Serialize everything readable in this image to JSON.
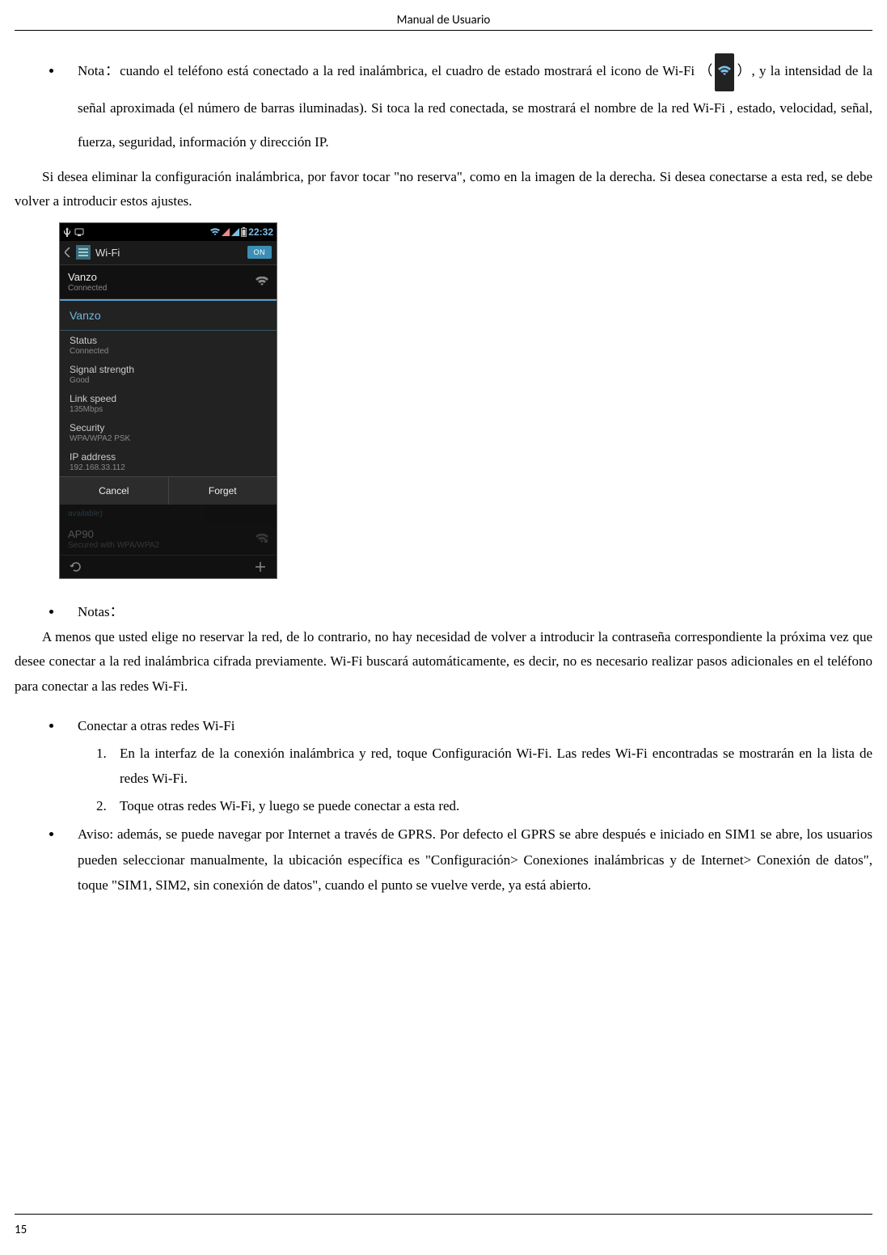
{
  "header": {
    "title": "Manual de Usuario"
  },
  "nota": {
    "label": "Nota：",
    "part1": "cuando el teléfono está conectado a la red inalámbrica, el cuadro de estado mostrará el icono de Wi-Fi （",
    "part2": "）, y la intensidad de la señal aproximada (el número de barras iluminadas). Si toca la red conectada, se mostrará el nombre de la red Wi-Fi , estado, velocidad, señal, fuerza, seguridad, información y dirección IP."
  },
  "flow1": "Si desea eliminar la configuración inalámbrica, por favor tocar \"no reserva\", como en la imagen de la derecha. Si desea conectarse a esta red, se debe volver a introducir estos ajustes.",
  "phone": {
    "time": "22:32",
    "appbar_title": "Wi-Fi",
    "toggle": "ON",
    "net1": {
      "name": "Vanzo",
      "sub": "Connected"
    },
    "dialog": {
      "title": "Vanzo",
      "status_l": "Status",
      "status_v": "Connected",
      "signal_l": "Signal strength",
      "signal_v": "Good",
      "link_l": "Link speed",
      "link_v": "135Mbps",
      "sec_l": "Security",
      "sec_v": "WPA/WPA2 PSK",
      "ip_l": "IP address",
      "ip_v": "192.168.33.112",
      "cancel": "Cancel",
      "forget": "Forget"
    },
    "avail": "available)",
    "net2": {
      "name": "AP90",
      "sub": "Secured with WPA/WPA2"
    }
  },
  "notas": {
    "label": "Notas："
  },
  "flow2": "A menos que usted elige no reservar la red, de lo contrario, no hay necesidad de volver a introducir la contraseña correspondiente la próxima vez que desee conectar a la red inalámbrica cifrada previamente. Wi-Fi buscará automáticamente, es decir, no es necesario realizar pasos adicionales en el teléfono para conectar a las redes Wi-Fi.",
  "conectar": {
    "title": "Conectar a otras redes Wi-Fi",
    "step1": "En la interfaz de la conexión inalámbrica y red, toque Configuración Wi-Fi. Las redes Wi-Fi encontradas se mostrarán en la lista de redes Wi-Fi.",
    "step2": "Toque otras redes Wi-Fi, y luego se puede conectar a esta red."
  },
  "aviso": "Aviso: además, se puede navegar por Internet a través de GPRS. Por defecto el GPRS se abre después e iniciado en SIM1 se abre, los usuarios pueden seleccionar manualmente, la ubicación específica es \"Configuración> Conexiones inalámbricas y de Internet> Conexión de datos\", toque \"SIM1, SIM2, sin conexión de datos\", cuando el punto se vuelve verde, ya está abierto.",
  "page_num": "15"
}
